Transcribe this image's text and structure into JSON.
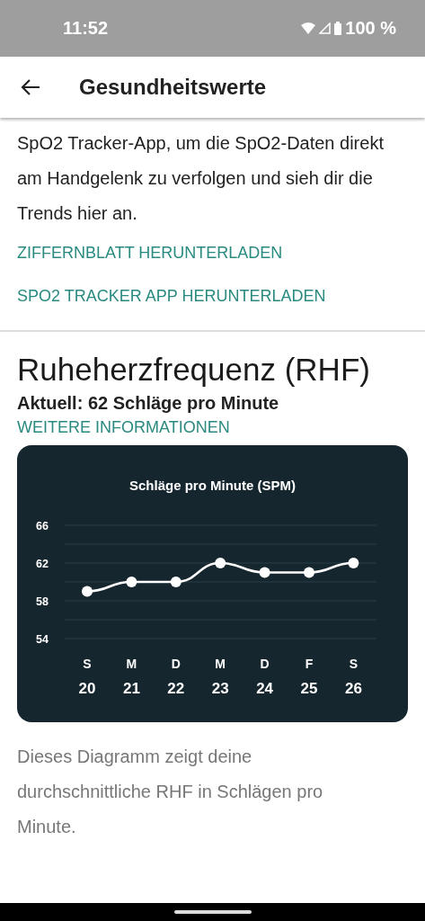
{
  "status_bar": {
    "time": "11:52",
    "battery": "100 %"
  },
  "app_bar": {
    "title": "Gesundheitswerte"
  },
  "spo2_section": {
    "text": "SpO2 Tracker-App, um die SpO2-Daten direkt am Handgelenk zu verfolgen und sieh dir die Trends hier an.",
    "links": [
      "ZIFFERNBLATT HERUNTERLADEN",
      "SPO2 TRACKER APP HERUNTERLADEN"
    ]
  },
  "rhr_section": {
    "title": "Ruheherzfrequenz (RHF)",
    "current": "Aktuell: 62 Schläge pro Minute",
    "link": "WEITERE INFORMATIONEN",
    "chart_data": {
      "type": "line",
      "title": "Schläge pro Minute (SPM)",
      "categories": [
        {
          "day": "S",
          "date": "20"
        },
        {
          "day": "M",
          "date": "21"
        },
        {
          "day": "D",
          "date": "22"
        },
        {
          "day": "M",
          "date": "23"
        },
        {
          "day": "D",
          "date": "24"
        },
        {
          "day": "F",
          "date": "25"
        },
        {
          "day": "S",
          "date": "26"
        }
      ],
      "series": [
        {
          "color": "#ffffff",
          "marker": "circle",
          "values": [
            59,
            60,
            60,
            62,
            61,
            61,
            62
          ]
        }
      ],
      "ylim": [
        54,
        66
      ],
      "yticks": [
        54,
        58,
        62,
        66
      ]
    },
    "caption": "Dieses Diagramm zeigt deine durchschnittliche RHF in Schlägen pro Minute."
  }
}
